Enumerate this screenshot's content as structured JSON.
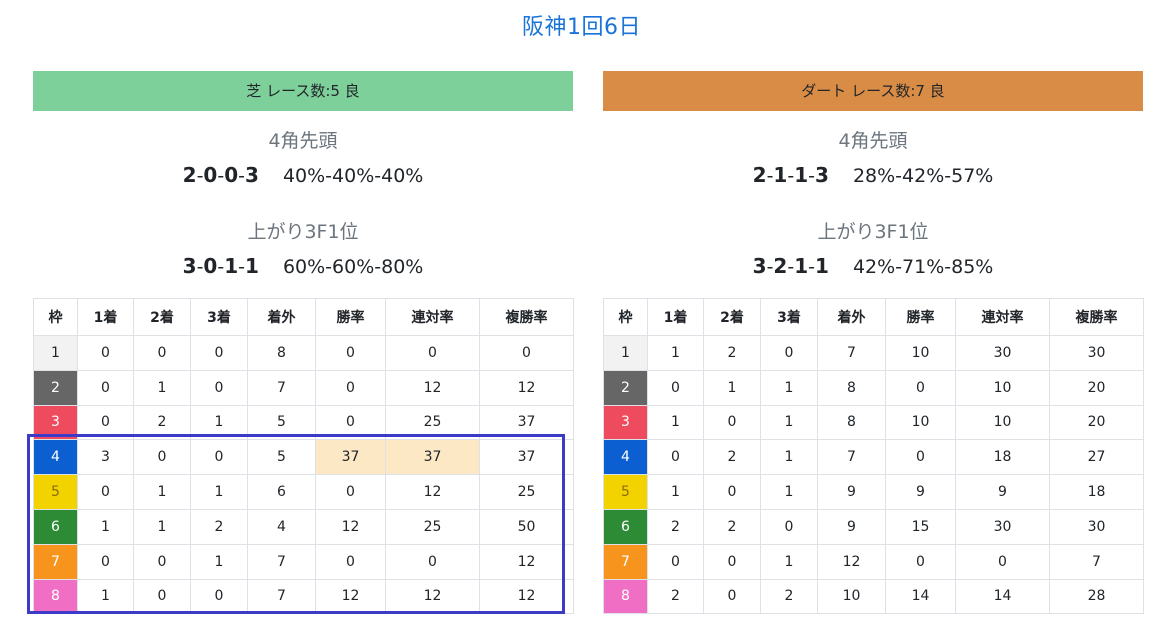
{
  "page_title": "阪神1回6日",
  "colors": {
    "title": "#1a73d9",
    "turf_banner": "#7dd09a",
    "dirt_banner": "#d98c45",
    "highlight_cell": "#fde8c6",
    "highlight_box": "#3b3bc7",
    "waku": [
      "#f2f2f2",
      "#666666",
      "#ef4b5f",
      "#0b5fd0",
      "#f2d300",
      "#2e8b35",
      "#f7941d",
      "#f06fc4"
    ]
  },
  "turf": {
    "banner": "芝 レース数:5  良",
    "corner_label": "4角先頭",
    "corner_counts": [
      "2",
      "0",
      "0",
      "3"
    ],
    "corner_pct": "40%-40%-40%",
    "last3f_label": "上がり3F1位",
    "last3f_counts": [
      "3",
      "0",
      "1",
      "1"
    ],
    "last3f_pct": "60%-60%-80%",
    "headers": [
      "枠",
      "1着",
      "2着",
      "3着",
      "着外",
      "勝率",
      "連対率",
      "複勝率"
    ],
    "rows": [
      [
        "1",
        "0",
        "0",
        "0",
        "8",
        "0",
        "0",
        "0"
      ],
      [
        "2",
        "0",
        "1",
        "0",
        "7",
        "0",
        "12",
        "12"
      ],
      [
        "3",
        "0",
        "2",
        "1",
        "5",
        "0",
        "25",
        "37"
      ],
      [
        "4",
        "3",
        "0",
        "0",
        "5",
        "37",
        "37",
        "37"
      ],
      [
        "5",
        "0",
        "1",
        "1",
        "6",
        "0",
        "12",
        "25"
      ],
      [
        "6",
        "1",
        "1",
        "2",
        "4",
        "12",
        "25",
        "50"
      ],
      [
        "7",
        "0",
        "0",
        "1",
        "7",
        "0",
        "0",
        "12"
      ],
      [
        "8",
        "1",
        "0",
        "0",
        "7",
        "12",
        "12",
        "12"
      ]
    ]
  },
  "dirt": {
    "banner": "ダート レース数:7  良",
    "corner_label": "4角先頭",
    "corner_counts": [
      "2",
      "1",
      "1",
      "3"
    ],
    "corner_pct": "28%-42%-57%",
    "last3f_label": "上がり3F1位",
    "last3f_counts": [
      "3",
      "2",
      "1",
      "1"
    ],
    "last3f_pct": "42%-71%-85%",
    "headers": [
      "枠",
      "1着",
      "2着",
      "3着",
      "着外",
      "勝率",
      "連対率",
      "複勝率"
    ],
    "rows": [
      [
        "1",
        "1",
        "2",
        "0",
        "7",
        "10",
        "30",
        "30"
      ],
      [
        "2",
        "0",
        "1",
        "1",
        "8",
        "0",
        "10",
        "20"
      ],
      [
        "3",
        "1",
        "0",
        "1",
        "8",
        "10",
        "10",
        "20"
      ],
      [
        "4",
        "0",
        "2",
        "1",
        "7",
        "0",
        "18",
        "27"
      ],
      [
        "5",
        "1",
        "0",
        "1",
        "9",
        "9",
        "9",
        "18"
      ],
      [
        "6",
        "2",
        "2",
        "0",
        "9",
        "15",
        "30",
        "30"
      ],
      [
        "7",
        "0",
        "0",
        "1",
        "12",
        "0",
        "0",
        "7"
      ],
      [
        "8",
        "2",
        "0",
        "2",
        "10",
        "14",
        "14",
        "28"
      ]
    ]
  }
}
